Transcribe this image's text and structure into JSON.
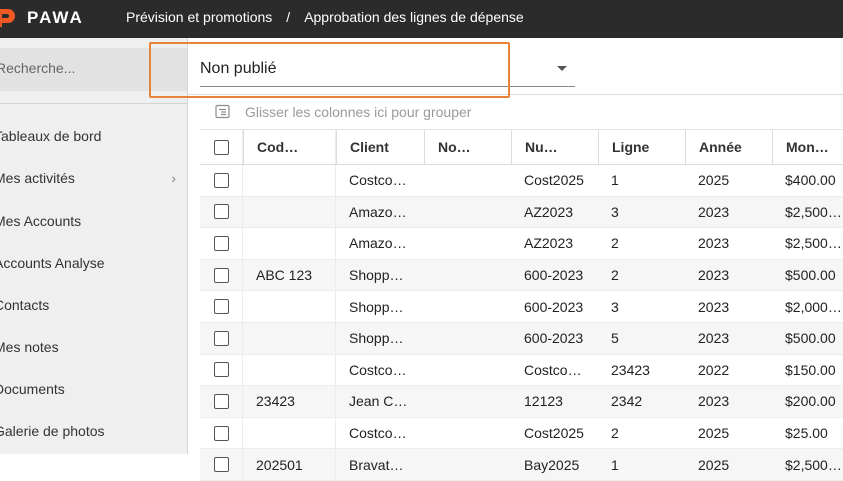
{
  "app": {
    "logo_text": "PAWA"
  },
  "breadcrumb": {
    "items": [
      "Prévision et promotions",
      "Approbation des lignes de dépense"
    ],
    "separator": "/"
  },
  "sidebar": {
    "search_placeholder": "Recherche...",
    "items": [
      {
        "label": "Tableaux de bord",
        "has_chevron": false
      },
      {
        "label": "Mes activités",
        "has_chevron": true
      },
      {
        "label": "Mes Accounts",
        "has_chevron": false
      },
      {
        "label": "Accounts Analyse",
        "has_chevron": false
      },
      {
        "label": "Contacts",
        "has_chevron": false
      },
      {
        "label": "Mes notes",
        "has_chevron": false
      },
      {
        "label": "Documents",
        "has_chevron": false
      },
      {
        "label": "Galerie de photos",
        "has_chevron": false
      }
    ]
  },
  "filter": {
    "selected": "Non publié",
    "highlight_color": "#e8833a"
  },
  "group_panel": {
    "text": "Glisser les colonnes ici pour grouper"
  },
  "grid": {
    "columns": [
      "Cod…",
      "Client",
      "No…",
      "Nu…",
      "Ligne",
      "Année",
      "Mon…"
    ],
    "rows": [
      [
        "",
        "Costco…",
        "",
        "Cost2025",
        "1",
        "2025",
        "$400.00"
      ],
      [
        "",
        "Amazo…",
        "",
        "AZ2023",
        "3",
        "2023",
        "$2,500…"
      ],
      [
        "",
        "Amazo…",
        "",
        "AZ2023",
        "2",
        "2023",
        "$2,500…"
      ],
      [
        "ABC 123",
        "Shopp…",
        "",
        "600-2023",
        "2",
        "2023",
        "$500.00"
      ],
      [
        "",
        "Shopp…",
        "",
        "600-2023",
        "3",
        "2023",
        "$2,000…"
      ],
      [
        "",
        "Shopp…",
        "",
        "600-2023",
        "5",
        "2023",
        "$500.00"
      ],
      [
        "",
        "Costco…",
        "",
        "Costco…",
        "23423",
        "2022",
        "$150.00"
      ],
      [
        "23423",
        "Jean C…",
        "",
        "12123",
        "2342",
        "2023",
        "$200.00"
      ],
      [
        "",
        "Costco…",
        "",
        "Cost2025",
        "2",
        "2025",
        "$25.00"
      ],
      [
        "202501",
        "Bravat…",
        "",
        "Bay2025",
        "1",
        "2025",
        "$2,500…"
      ]
    ]
  }
}
